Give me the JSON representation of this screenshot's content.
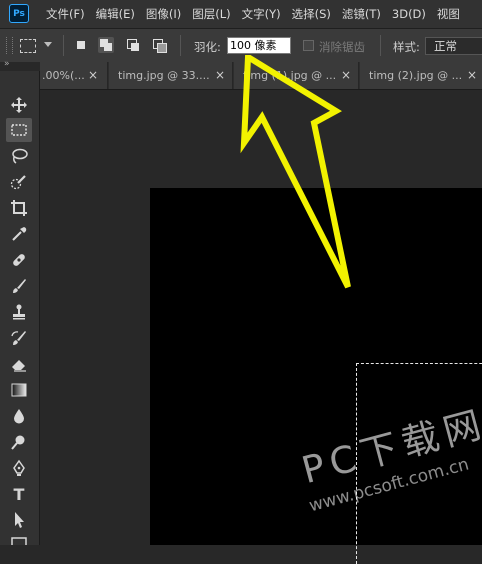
{
  "app": {
    "logo_text": "Ps"
  },
  "menu": [
    "文件(F)",
    "编辑(E)",
    "图像(I)",
    "图层(L)",
    "文字(Y)",
    "选择(S)",
    "滤镜(T)",
    "3D(D)",
    "视图"
  ],
  "options": {
    "feather_label": "羽化:",
    "feather_value": "100 像素",
    "antialias_label": "消除锯齿",
    "style_label": "样式:",
    "style_value": "正常"
  },
  "tabs": [
    {
      "label": ".00%(...",
      "close": "×"
    },
    {
      "label": "timg.jpg @ 33....",
      "close": "×"
    },
    {
      "label": "timg (1).jpg @ ...",
      "close": "×"
    },
    {
      "label": "timg (2).jpg @ ...",
      "close": "×"
    }
  ],
  "toolbar": {
    "collapse": "»",
    "tools": [
      {
        "name": "move-tool",
        "icon": "move-icon"
      },
      {
        "name": "rect-marquee-tool",
        "icon": "rect-marquee-icon",
        "active": true
      },
      {
        "name": "lasso-tool",
        "icon": "lasso-icon"
      },
      {
        "name": "quick-selection-tool",
        "icon": "quick-select-icon"
      },
      {
        "name": "crop-tool",
        "icon": "crop-icon"
      },
      {
        "name": "eyedropper-tool",
        "icon": "eyedropper-icon"
      },
      {
        "name": "healing-brush-tool",
        "icon": "bandage-icon"
      },
      {
        "name": "brush-tool",
        "icon": "brush-icon"
      },
      {
        "name": "clone-stamp-tool",
        "icon": "stamp-icon"
      },
      {
        "name": "history-brush-tool",
        "icon": "history-brush-icon"
      },
      {
        "name": "eraser-tool",
        "icon": "eraser-icon"
      },
      {
        "name": "gradient-tool",
        "icon": "gradient-icon"
      },
      {
        "name": "blur-tool",
        "icon": "drop-icon"
      },
      {
        "name": "dodge-tool",
        "icon": "dodge-icon"
      },
      {
        "name": "pen-tool",
        "icon": "pen-icon"
      },
      {
        "name": "type-tool",
        "icon": "type-icon",
        "glyph": "T"
      },
      {
        "name": "path-selection-tool",
        "icon": "arrow-icon"
      }
    ]
  },
  "watermark": {
    "title": "PC下载网",
    "url": "www.pcsoft.com.cn"
  },
  "colors": {
    "arrow": "#f2f200",
    "ps_blue": "#31a8ff"
  }
}
